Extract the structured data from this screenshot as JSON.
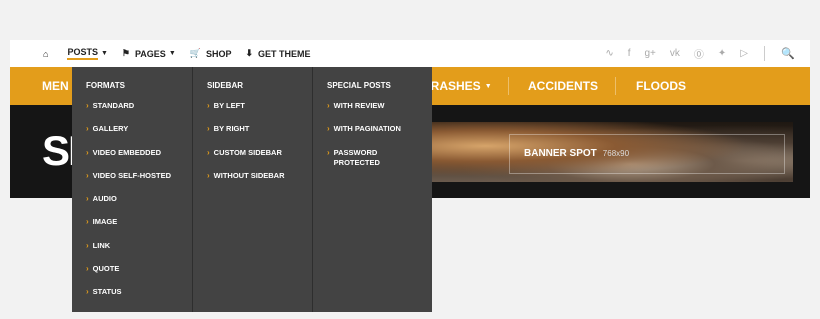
{
  "topnav": {
    "items": [
      {
        "icon": "home-icon",
        "glyph": "⌂",
        "label": ""
      },
      {
        "label": "Posts",
        "chevron": "▼",
        "active": true
      },
      {
        "icon": "flag-icon",
        "glyph": "⚑",
        "label": "Pages",
        "chevron": "▼"
      },
      {
        "icon": "shop-icon",
        "glyph": "🛒",
        "label": "Shop"
      },
      {
        "icon": "download-icon",
        "glyph": "⬇",
        "label": "Get Theme"
      }
    ],
    "social": [
      {
        "name": "rss-icon",
        "glyph": "∿"
      },
      {
        "name": "facebook-icon",
        "glyph": "f"
      },
      {
        "name": "google-plus-icon",
        "glyph": "g+"
      },
      {
        "name": "vk-icon",
        "glyph": "vk"
      },
      {
        "name": "pinterest-icon",
        "glyph": "⓪"
      },
      {
        "name": "twitter-icon",
        "glyph": "✦"
      },
      {
        "name": "youtube-icon",
        "glyph": "▷"
      }
    ],
    "search_glyph": "🔍"
  },
  "mainnav": {
    "items": [
      {
        "label": "Men"
      },
      {
        "label": "Crashes",
        "chevron": "▼"
      },
      {
        "label": "Accidents"
      },
      {
        "label": "Floods"
      }
    ]
  },
  "logo": {
    "text": "SE"
  },
  "banner": {
    "title": "Banner Spot",
    "size": "768x90"
  },
  "dropdown": {
    "columns": [
      {
        "title": "Formats",
        "items": [
          "Standard",
          "Gallery",
          "Video Embedded",
          "Video Self-Hosted",
          "Audio",
          "Image",
          "Link",
          "Quote",
          "Status"
        ]
      },
      {
        "title": "Sidebar",
        "items": [
          "By Left",
          "By Right",
          "Custom Sidebar",
          "Without Sidebar"
        ]
      },
      {
        "title": "Special Posts",
        "items": [
          "With Review",
          "With Pagination",
          "Password Protected"
        ]
      }
    ],
    "arrow": "›"
  },
  "colors": {
    "accent": "#e39d1b",
    "dropdown_bg": "#434343",
    "header_bg": "#151515"
  }
}
